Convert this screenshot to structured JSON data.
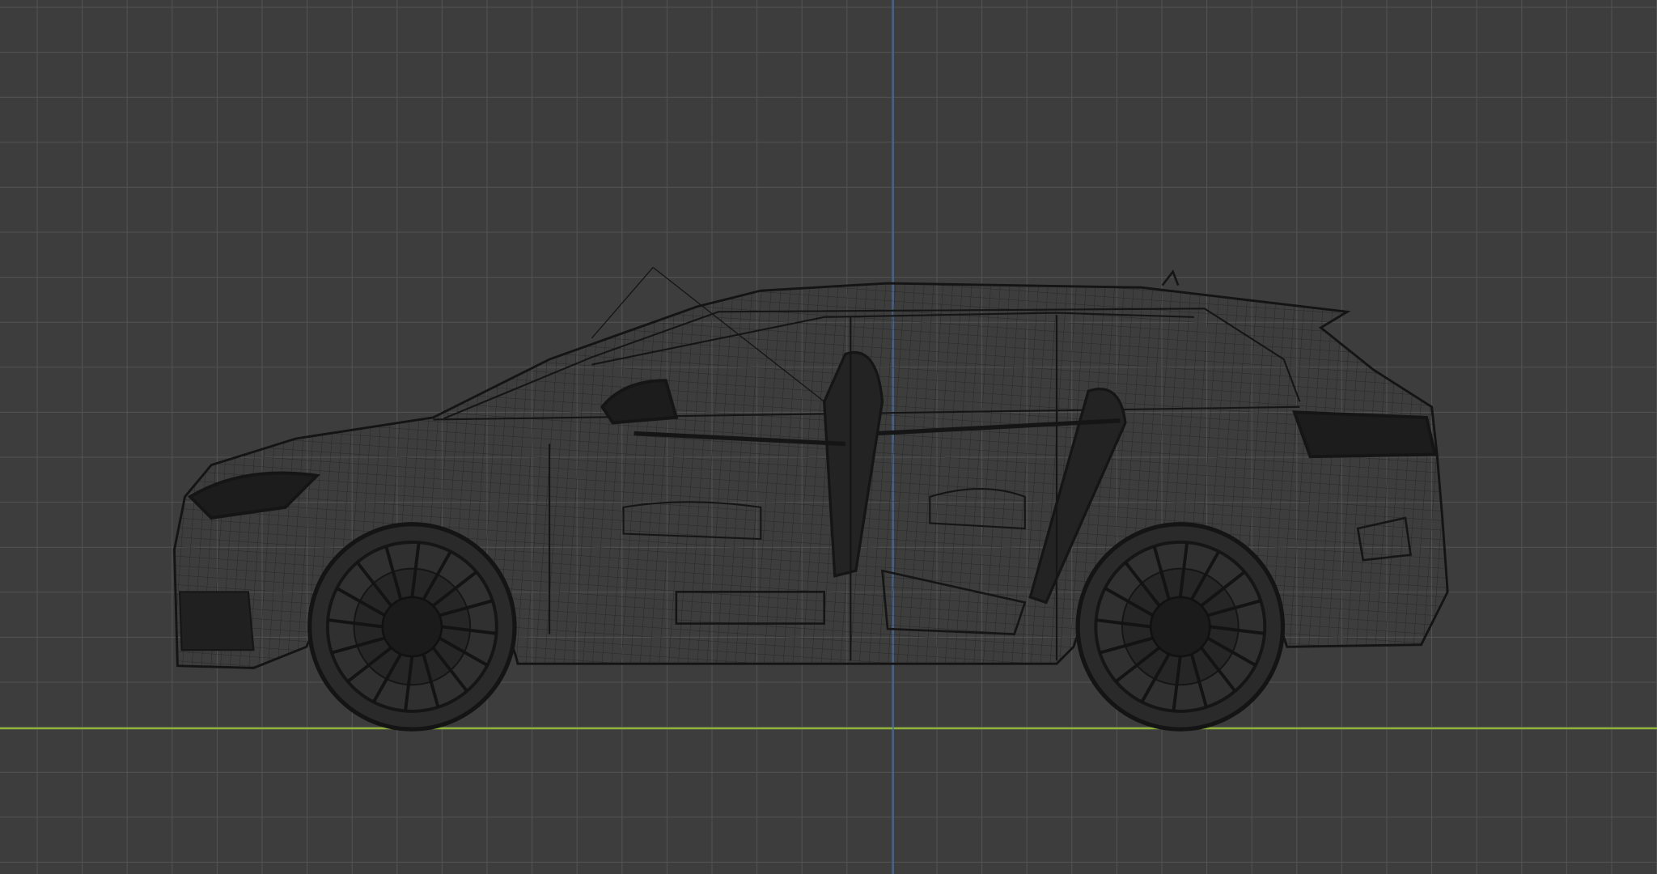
{
  "viewport": {
    "background_color": "#3d3d3d",
    "grid_color": "#545454",
    "x_axis_color": "#8fb13a",
    "z_axis_color": "#3f6fb5",
    "wire_color": "#161616"
  },
  "model": {
    "wheel_spoke_count": 16
  }
}
